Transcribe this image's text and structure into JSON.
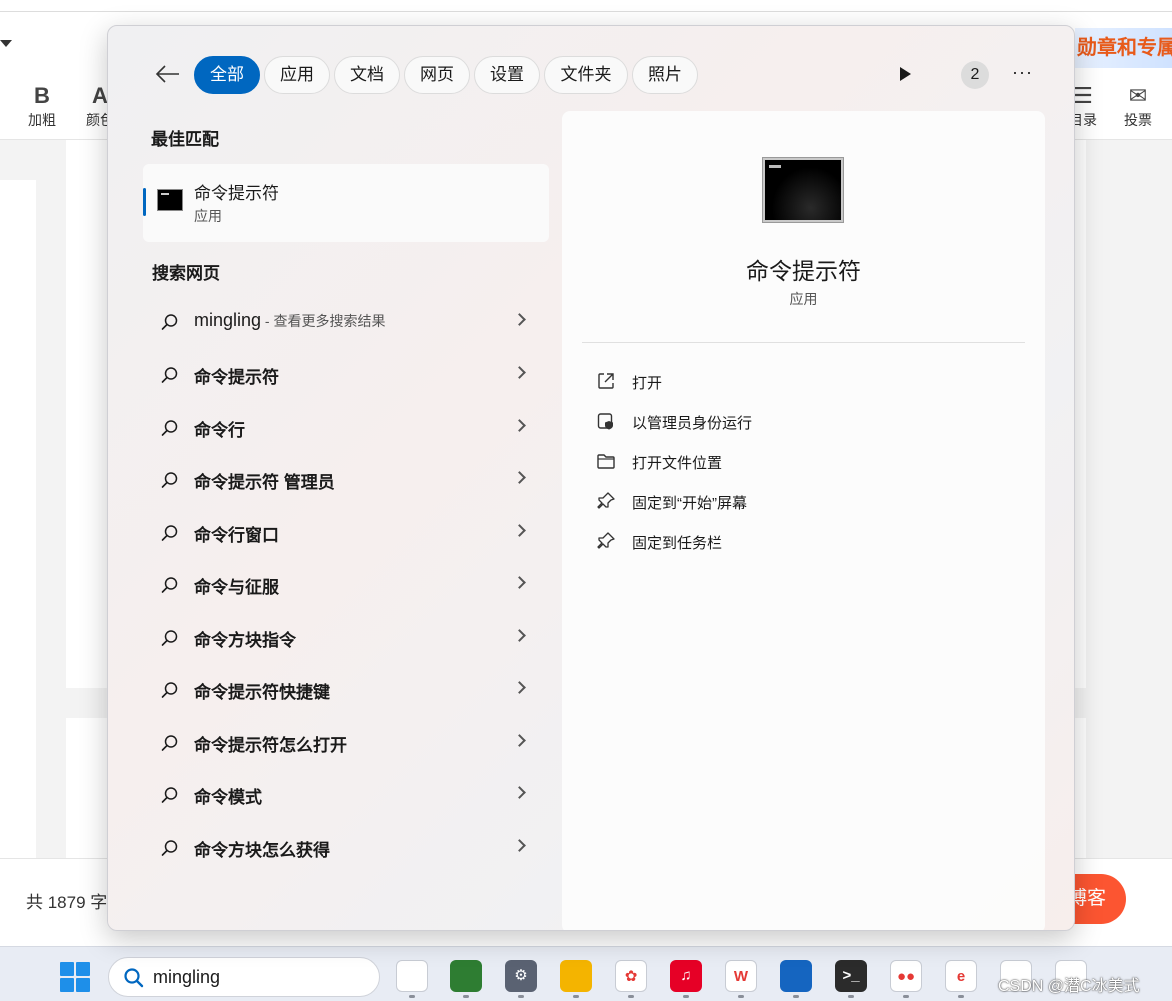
{
  "background": {
    "toolbar": [
      {
        "glyph": "B",
        "label": "加粗"
      },
      {
        "glyph": "A",
        "label": "颜色"
      },
      {
        "glyph": "☰",
        "label": "目录"
      },
      {
        "glyph": "✉",
        "label": "投票"
      }
    ],
    "banner_text": "勋章和专属",
    "word_count": "共 1879 字",
    "publish_label": "博客"
  },
  "search_panel": {
    "filter_tabs": [
      "全部",
      "应用",
      "文档",
      "网页",
      "设置",
      "文件夹",
      "照片"
    ],
    "active_tab": "全部",
    "badge_count": "2",
    "more_label": "···",
    "best_match": {
      "heading": "最佳匹配",
      "name": "命令提示符",
      "kind": "应用",
      "icon": "command-prompt-icon"
    },
    "web": {
      "heading": "搜索网页",
      "first": {
        "query": "mingling",
        "suffix": " - 查看更多搜索结果"
      },
      "suggestions": [
        "命令提示符",
        "命令行",
        "命令提示符 管理员",
        "命令行窗口",
        "命令与征服",
        "命令方块指令",
        "命令提示符快捷键",
        "命令提示符怎么打开",
        "命令模式",
        "命令方块怎么获得"
      ]
    },
    "detail": {
      "title": "命令提示符",
      "kind": "应用",
      "actions": [
        {
          "label": "打开",
          "icon": "open-external-icon"
        },
        {
          "label": "以管理员身份运行",
          "icon": "shield-admin-icon"
        },
        {
          "label": "打开文件位置",
          "icon": "folder-icon"
        },
        {
          "label": "固定到“开始”屏幕",
          "icon": "pin-icon"
        },
        {
          "label": "固定到任务栏",
          "icon": "pin-icon"
        }
      ]
    }
  },
  "taskbar": {
    "search_value": "mingling",
    "apps": [
      {
        "name": "file-icon",
        "glyph": "",
        "color": "#ffffff"
      },
      {
        "name": "magnifier-globe-icon",
        "glyph": "",
        "color": "#2e7d32"
      },
      {
        "name": "settings-gear-icon",
        "glyph": "⚙",
        "color": "#5a6272"
      },
      {
        "name": "file-explorer-icon",
        "glyph": "",
        "color": "#f4b400"
      },
      {
        "name": "photos-icon",
        "glyph": "✿",
        "color": "#ffffff"
      },
      {
        "name": "netease-music-icon",
        "glyph": "♫",
        "color": "#e60026"
      },
      {
        "name": "wps-icon",
        "glyph": "W",
        "color": "#ffffff"
      },
      {
        "name": "defender-shield-icon",
        "glyph": "",
        "color": "#1565c0"
      },
      {
        "name": "terminal-icon",
        "glyph": ">_",
        "color": "#2b2b2b"
      },
      {
        "name": "wechat-icon",
        "glyph": "●●",
        "color": "#ffffff"
      },
      {
        "name": "edge-ie-icon",
        "glyph": "e",
        "color": "#ffffff"
      },
      {
        "name": "remote-desktop-icon",
        "glyph": "",
        "color": "#ffffff"
      },
      {
        "name": "notepad-icon",
        "glyph": "",
        "color": "#ffffff"
      }
    ],
    "watermark": "CSDN @潜C冰美式"
  },
  "colors": {
    "accent": "#0067c0",
    "publish": "#fc5531"
  }
}
